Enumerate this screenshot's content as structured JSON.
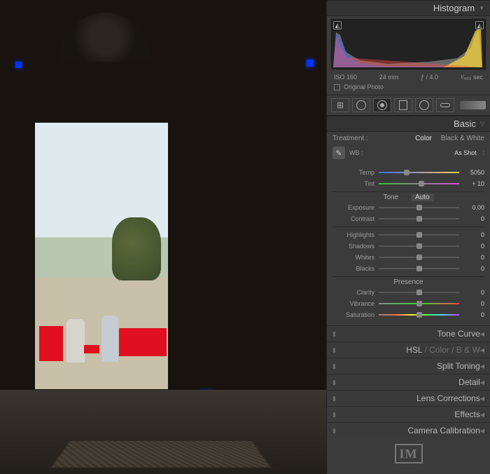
{
  "sections": {
    "histogram": {
      "title": "Histogram"
    },
    "basic": {
      "title": "Basic"
    }
  },
  "meta": {
    "iso": "ISO 160",
    "focal": "24 mm",
    "aperture": "ƒ / 4.0",
    "shutter": "¹⁄₄₀₀ sec"
  },
  "original_photo": {
    "label": "Original Photo"
  },
  "treatment": {
    "label": "Treatment :",
    "color": "Color",
    "bw": "Black & White"
  },
  "wb": {
    "label": "WB :",
    "value": "As Shot"
  },
  "sliders": {
    "temp": {
      "label": "Temp",
      "value": "5050"
    },
    "tint": {
      "label": "Tint",
      "value": "+ 10"
    },
    "exposure": {
      "label": "Exposure",
      "value": "0.00"
    },
    "contrast": {
      "label": "Contrast",
      "value": "0"
    },
    "highlights": {
      "label": "Highlights",
      "value": "0"
    },
    "shadows": {
      "label": "Shadows",
      "value": "0"
    },
    "whites": {
      "label": "Whites",
      "value": "0"
    },
    "blacks": {
      "label": "Blacks",
      "value": "0"
    },
    "clarity": {
      "label": "Clarity",
      "value": "0"
    },
    "vibrance": {
      "label": "Vibrance",
      "value": "0"
    },
    "saturation": {
      "label": "Saturation",
      "value": "0"
    }
  },
  "headings": {
    "tone": "Tone",
    "auto": "Auto",
    "presence": "Presence"
  },
  "collapsed": {
    "tone_curve": "Tone Curve",
    "hsl_prefix": "HSL",
    "hsl_sep1": " / ",
    "hsl_color": "Color",
    "hsl_sep2": " / ",
    "hsl_bw": "B & W",
    "split_toning": "Split Toning",
    "detail": "Detail",
    "lens": "Lens Corrections",
    "effects": "Effects",
    "camera_cal": "Camera Calibration"
  },
  "logo": "IM"
}
